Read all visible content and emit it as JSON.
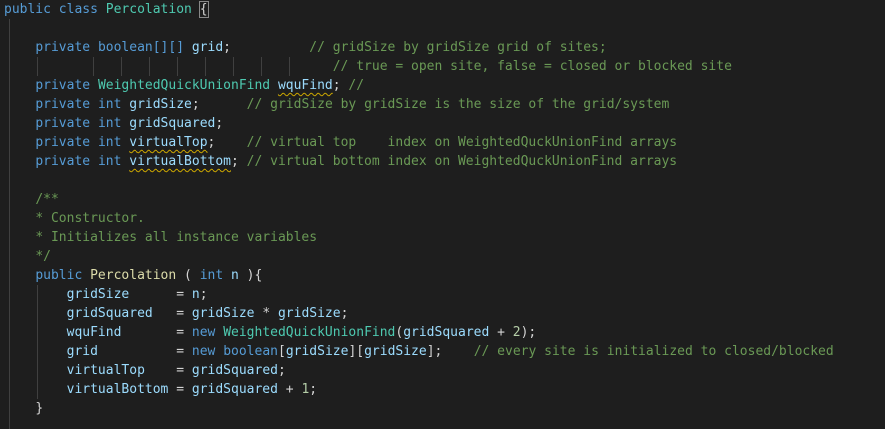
{
  "code": {
    "class_decl": {
      "kw1": "public",
      "kw2": "class",
      "name": "Percolation",
      "brace": "{"
    },
    "lines": [
      {
        "id": "l1-blank"
      },
      {
        "id": "grid-decl",
        "kw": "private",
        "type": "boolean[][]",
        "name": "grid",
        "punct": ";",
        "comment": "// gridSize by gridSize grid of sites;"
      },
      {
        "id": "grid-comment2",
        "comment": "// true = open site, false = closed or blocked site"
      },
      {
        "id": "wqu-decl",
        "kw": "private",
        "type": "WeightedQuickUnionFind",
        "name": "wquFind",
        "punct": ";",
        "comment": "//"
      },
      {
        "id": "gridsize-decl",
        "kw": "private",
        "type": "int",
        "name": "gridSize",
        "punct": ";",
        "comment": "// gridSize by gridSize is the size of the grid/system"
      },
      {
        "id": "gridsq-decl",
        "kw": "private",
        "type": "int",
        "name": "gridSquared",
        "punct": ";"
      },
      {
        "id": "vtop-decl",
        "kw": "private",
        "type": "int",
        "name": "virtualTop",
        "punct": ";",
        "comment": "// virtual top    index on WeightedQuckUnionFind arrays"
      },
      {
        "id": "vbot-decl",
        "kw": "private",
        "type": "int",
        "name": "virtualBottom",
        "punct": ";",
        "comment": "// virtual bottom index on WeightedQuckUnionFind arrays"
      }
    ],
    "doc": {
      "open": "/**",
      "line1": "* Constructor.",
      "line2": "* Initializes all instance variables",
      "close": "*/"
    },
    "ctor": {
      "kw": "public",
      "name": "Percolation",
      "open_paren": "( ",
      "param_type": "int",
      "param_name": "n",
      "close": " ){"
    },
    "body": {
      "a1_name": "gridSize",
      "a1_rhs": "n",
      "a2_name": "gridSquared",
      "a2_rhs1": "gridSize",
      "a2_op": "*",
      "a2_rhs2": "gridSize",
      "a3_name": "wquFind",
      "a3_new": "new",
      "a3_type": "WeightedQuickUnionFind",
      "a3_arg": "gridSquared",
      "a3_num": "2",
      "a4_name": "grid",
      "a4_new": "new",
      "a4_type": "boolean",
      "a4_idx1": "gridSize",
      "a4_idx2": "gridSize",
      "a4_comment": "// every site is initialized to closed/blocked",
      "a5_name": "virtualTop",
      "a5_rhs": "gridSquared",
      "a6_name": "virtualBottom",
      "a6_rhs": "gridSquared",
      "a6_num": "1",
      "close_brace": "}"
    }
  },
  "colors": {
    "background": "#1e1e1e",
    "keyword": "#569cd6",
    "type": "#4ec9b0",
    "function": "#dcdcaa",
    "variable": "#9cdcfe",
    "comment": "#6a9955",
    "number": "#b5cea8"
  }
}
